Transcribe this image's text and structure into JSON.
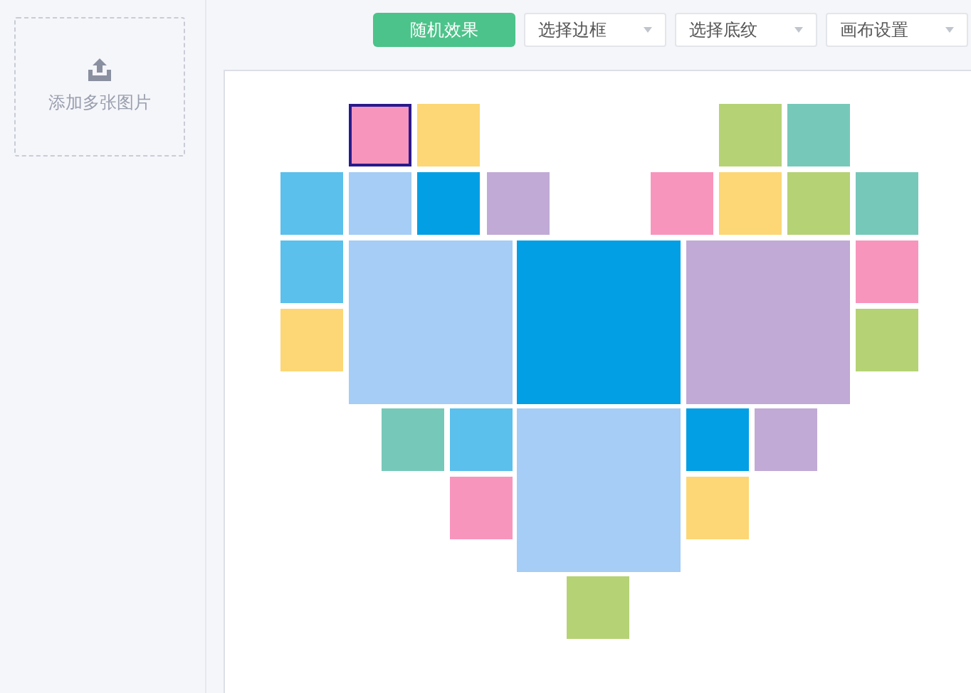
{
  "sidebar": {
    "upload": {
      "label": "添加多张图片"
    }
  },
  "toolbar": {
    "random_button": "随机效果",
    "dropdowns": [
      "选择边框",
      "选择底纹",
      "画布设置"
    ]
  },
  "canvas": {
    "tiles": [
      {
        "color": "#f895bd",
        "selected": true
      },
      {
        "color": "#fdd776",
        "selected": false
      },
      {
        "color": "#b5d275",
        "selected": false
      },
      {
        "color": "#76c9b9",
        "selected": false
      },
      {
        "color": "#5bc0eb",
        "selected": false
      },
      {
        "color": "#a5cdf5",
        "selected": false
      },
      {
        "color": "#039fe4",
        "selected": false
      },
      {
        "color": "#c1aad6",
        "selected": false
      },
      {
        "color": "#f895bd",
        "selected": false
      },
      {
        "color": "#fdd776",
        "selected": false
      },
      {
        "color": "#b5d275",
        "selected": false
      },
      {
        "color": "#76c9b9",
        "selected": false
      },
      {
        "color": "#5bc0eb",
        "selected": false
      },
      {
        "color": "#a5cdf5",
        "selected": false
      },
      {
        "color": "#039fe4",
        "selected": false
      },
      {
        "color": "#c1aad6",
        "selected": false
      },
      {
        "color": "#f895bd",
        "selected": false
      },
      {
        "color": "#fdd776",
        "selected": false
      },
      {
        "color": "#b5d275",
        "selected": false
      },
      {
        "color": "#76c9b9",
        "selected": false
      },
      {
        "color": "#5bc0eb",
        "selected": false
      },
      {
        "color": "#a5cdf5",
        "selected": false
      },
      {
        "color": "#039fe4",
        "selected": false
      },
      {
        "color": "#c1aad6",
        "selected": false
      },
      {
        "color": "#f895bd",
        "selected": false
      },
      {
        "color": "#fdd776",
        "selected": false
      },
      {
        "color": "#b5d275",
        "selected": false
      }
    ]
  }
}
